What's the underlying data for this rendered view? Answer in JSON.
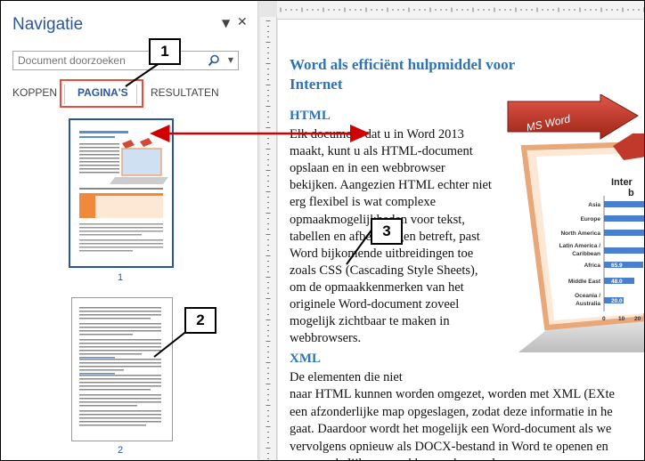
{
  "nav": {
    "title": "Navigatie",
    "search_placeholder": "Document doorzoeken",
    "tabs": [
      {
        "label": "KOPPEN"
      },
      {
        "label": "PAGINA'S"
      },
      {
        "label": "RESULTATEN"
      }
    ],
    "pages": [
      {
        "number": "1"
      },
      {
        "number": "2"
      }
    ]
  },
  "callouts": [
    "1",
    "2",
    "3"
  ],
  "document": {
    "title_lines": [
      "Word als efficiënt hulpmiddel voor",
      "Internet"
    ],
    "html_heading": "HTML",
    "html_lines": [
      "Elk document dat u in Word 2013",
      "maakt, kunt u als HTML-document",
      "opslaan en in een webbrowser",
      "bekijken. Aangezien HTML echter niet",
      "erg flexibel is wat complexe",
      "opmaakmogelijkheden voor tekst,",
      "tabellen en afbeeldingen betreft, past",
      "Word bijkomende uitbreidingen toe",
      "zoals CSS (Cascading Style Sheets),",
      "om de opmaakkenmerken van het",
      "originele Word-document zoveel",
      "mogelijk zichtbaar te maken in",
      "webbrowsers."
    ],
    "xml_heading": "XML",
    "xml_lines": [
      "De elementen die niet",
      "naar HTML kunnen worden omgezet, worden met XML (EXte",
      "een afzonderlijke map opgeslagen, zodat deze informatie in he",
      "gaat. Daardoor wordt het mogelijk een Word-document als we",
      "vervolgens opnieuw als DOCX-bestand in Word te openen en",
      "oorspronkelijke opmaakkenmerken verloren gaan."
    ]
  },
  "illustration": {
    "badge": "MS Word",
    "title_fragment": "Inter",
    "subtitle_fragment": "b",
    "categories": [
      "Asia",
      "Europe",
      "North America",
      "Latin America / Caribbean",
      "Africa",
      "Middle East",
      "Oceania / Australia"
    ],
    "category_display": [
      "Asia",
      "Europe",
      "North America",
      "Latin America /",
      "Caribbean",
      "Africa",
      "Middle East",
      "Oceania /",
      "Australia"
    ],
    "values_visible": [
      "65.9",
      "48.0",
      "20.0"
    ],
    "x_ticks": [
      "0",
      "10",
      "20"
    ],
    "colors": {
      "bar": "#4a7fd0",
      "frame": "#e8a87a",
      "badge": "#c0392b"
    }
  }
}
